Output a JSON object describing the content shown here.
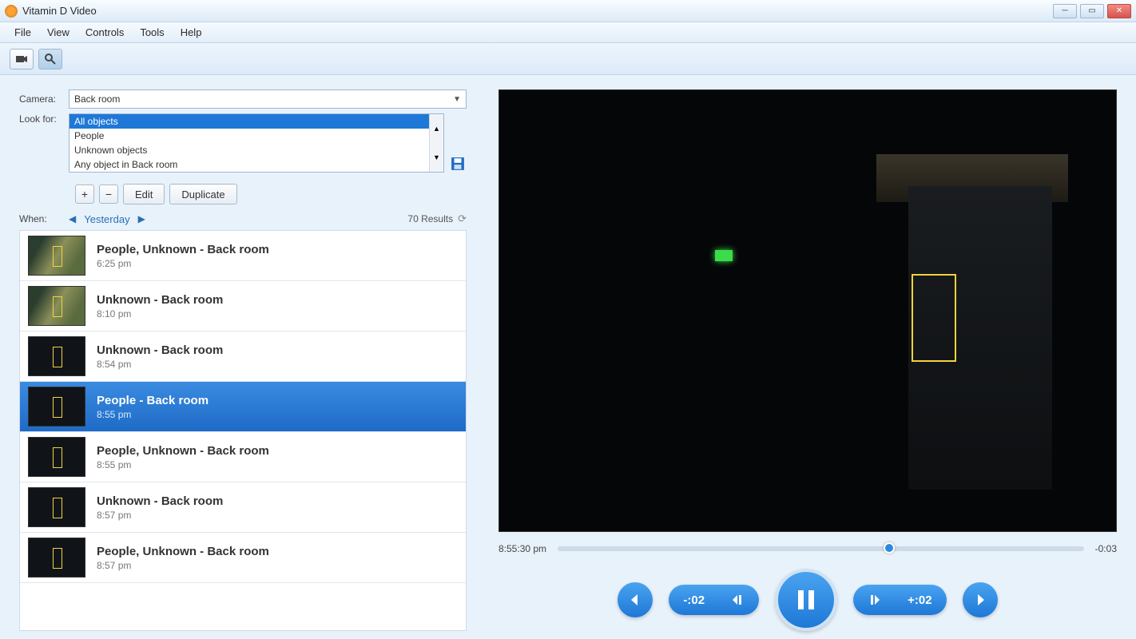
{
  "window": {
    "title": "Vitamin D Video"
  },
  "menu": {
    "items": [
      "File",
      "View",
      "Controls",
      "Tools",
      "Help"
    ]
  },
  "filters": {
    "camera_label": "Camera:",
    "camera_value": "Back room",
    "lookfor_label": "Look for:",
    "lookfor_options": [
      "All objects",
      "People",
      "Unknown objects",
      "Any object in Back room"
    ],
    "lookfor_selected": "All objects"
  },
  "buttons": {
    "edit": "Edit",
    "duplicate": "Duplicate"
  },
  "when": {
    "label": "When:",
    "current": "Yesterday",
    "results": "70 Results"
  },
  "events": [
    {
      "title": "People, Unknown - Back room",
      "time": "6:25 pm",
      "light": true
    },
    {
      "title": "Unknown - Back room",
      "time": "8:10 pm",
      "light": true
    },
    {
      "title": "Unknown - Back room",
      "time": "8:54 pm",
      "light": false
    },
    {
      "title": "People - Back room",
      "time": "8:55 pm",
      "light": false,
      "selected": true
    },
    {
      "title": "People, Unknown - Back room",
      "time": "8:55 pm",
      "light": false
    },
    {
      "title": "Unknown - Back room",
      "time": "8:57 pm",
      "light": false
    },
    {
      "title": "People, Unknown - Back room",
      "time": "8:57 pm",
      "light": false
    }
  ],
  "player": {
    "current_time": "8:55:30 pm",
    "remaining": "-0:03",
    "skip_back": "-:02",
    "skip_fwd": "+:02"
  }
}
